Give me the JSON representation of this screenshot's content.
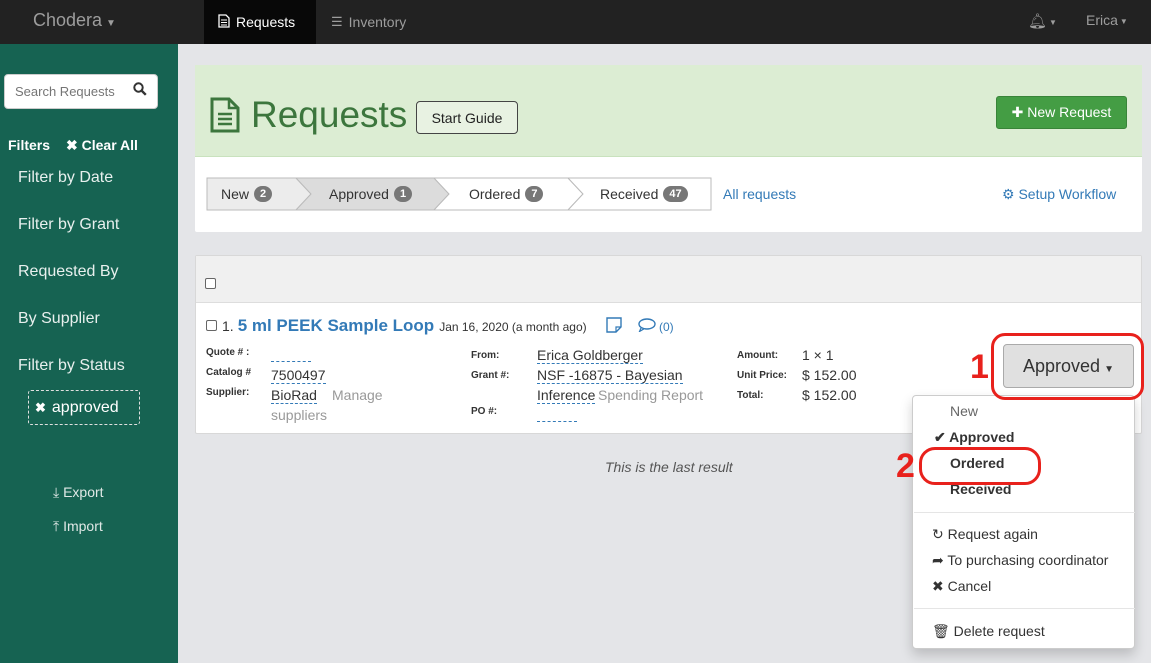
{
  "navbar": {
    "brand": "Chodera",
    "tabs": [
      {
        "label": "Requests"
      },
      {
        "label": "Inventory"
      }
    ],
    "user": "Erica"
  },
  "sidebar": {
    "search_placeholder": "Search Requests",
    "filters_label": "Filters",
    "clear_all_label": "Clear All",
    "filter_items": [
      "Filter by Date",
      "Filter by Grant",
      "Requested By",
      "By Supplier",
      "Filter by Status"
    ],
    "active_filter": "approved",
    "export_label": "Export",
    "import_label": "Import"
  },
  "header": {
    "title": "Requests",
    "start_guide_label": "Start Guide",
    "new_request_label": "New Request",
    "steps": [
      {
        "label": "New",
        "count": "2"
      },
      {
        "label": "Approved",
        "count": "1"
      },
      {
        "label": "Ordered",
        "count": "7"
      },
      {
        "label": "Received",
        "count": "47"
      }
    ],
    "all_requests_label": "All requests",
    "setup_workflow_label": "Setup Workflow"
  },
  "request": {
    "number": "1.",
    "title": "5 ml PEEK Sample Loop",
    "date": "Jan 16, 2020 (a month ago)",
    "comment_count": "(0)",
    "labels": {
      "quote": "Quote # :",
      "catalog": "Catalog #",
      "supplier": "Supplier:",
      "from": "From:",
      "grant": "Grant #:",
      "po": "PO #:",
      "amount": "Amount:",
      "unit_price": "Unit Price:",
      "total": "Total:"
    },
    "catalog_number": "7500497",
    "supplier_name": "BioRad",
    "manage_label": "Manage",
    "suppliers_label": "suppliers",
    "from_name": "Erica Goldberger",
    "grant_line1": "NSF -16875 - Bayesian",
    "grant_line2": "Inference",
    "spending_report_label": "Spending Report",
    "amount": "1 × 1",
    "unit_price": "$ 152.00",
    "total": "$ 152.00"
  },
  "last_result": "This is the last result",
  "status_dropdown": {
    "current": "Approved",
    "statuses": [
      "New",
      "Approved",
      "Ordered",
      "Received"
    ],
    "actions": [
      "Request again",
      "To purchasing coordinator",
      "Cancel"
    ],
    "delete_label": "Delete request"
  },
  "annotations": {
    "step1": "1",
    "step2": "2"
  },
  "colors": {
    "sidebar": "#166352",
    "link": "#337ab7",
    "success": "#449d44",
    "annotation": "#e8211c"
  }
}
